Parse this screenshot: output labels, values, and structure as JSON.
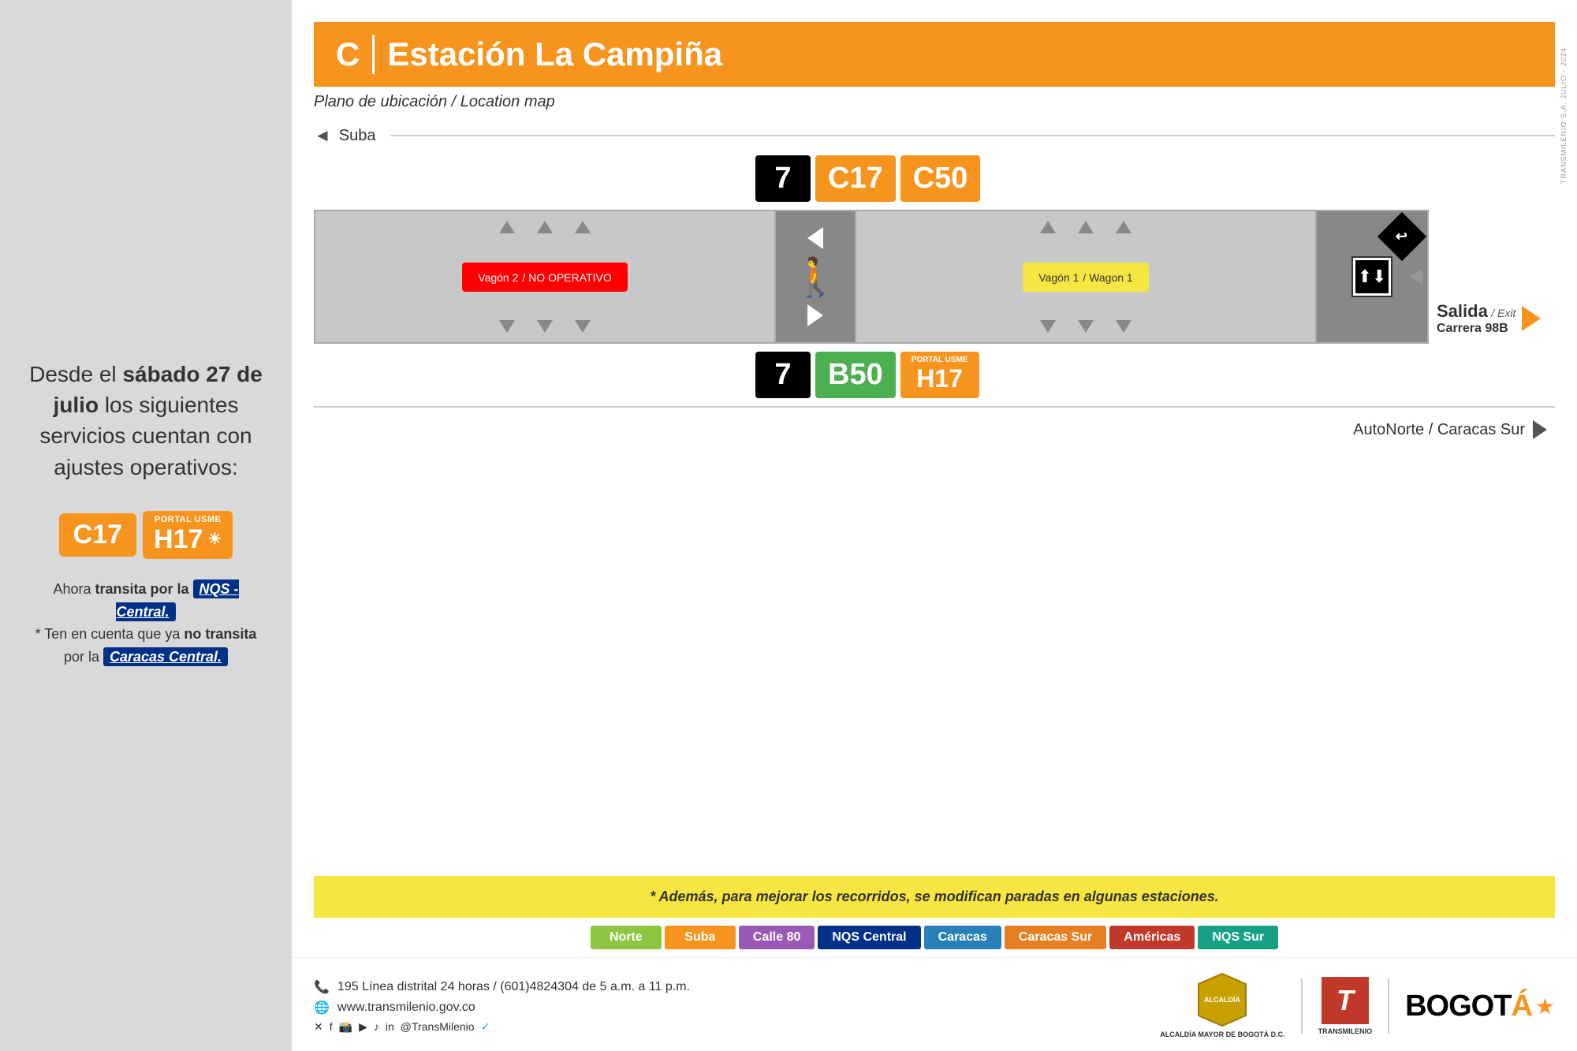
{
  "leftPanel": {
    "intro": "Desde el ",
    "dateStrong": "sábado 27 de julio",
    "rest": " los siguientes servicios cuentan con ajustes operativos:",
    "routes": {
      "c17Label": "C17",
      "h17Portal": "PORTAL USME",
      "h17Num": "H17"
    },
    "transitInfo1": "Ahora ",
    "transitStrong": "transita por la ",
    "nqsCentral": "NQS - Central.",
    "note": "* Ten en cuenta que ya ",
    "noTransita": "no transita",
    "noteRest": " por la ",
    "caracasCentral": "Caracas Central."
  },
  "header": {
    "letter": "C",
    "stationName": "Estación La Campiña",
    "subtitle": "Plano de ubicación",
    "subtitleEn": "/ Location map"
  },
  "verticalLabel": "TRANSMILENIO S.A. JULIO - 2024",
  "map": {
    "subaLabel": "Suba",
    "routesTop": {
      "r7": "7",
      "rC17": "C17",
      "rC50": "C50"
    },
    "wagon2": {
      "label": "Vagón 2",
      "sublabel": "/ NO OPERATIVO"
    },
    "wagon1": {
      "label": "Vagón 1",
      "sublabel": "/ Wagon 1"
    },
    "salida": "Salida",
    "salidaEn": "/ Exit",
    "carrera": "Carrera 98B",
    "routesBottom": {
      "r7": "7",
      "rB50": "B50",
      "h17Portal": "PORTAL USME",
      "rH17": "H17"
    },
    "autoNorte": "AutoNorte / Caracas Sur"
  },
  "banner": {
    "text": "* Además, para mejorar los recorridos, se modifican paradas en algunas estaciones."
  },
  "legend": {
    "items": [
      {
        "label": "Norte",
        "color": "#8dc63f"
      },
      {
        "label": "Suba",
        "color": "#f7941d"
      },
      {
        "label": "Calle 80",
        "color": "#9b59b6"
      },
      {
        "label": "NQS Central",
        "color": "#003087"
      },
      {
        "label": "Caracas",
        "color": "#2980b9"
      },
      {
        "label": "Caracas Sur",
        "color": "#e67e22"
      },
      {
        "label": "Américas",
        "color": "#c0392b"
      },
      {
        "label": "NQS Sur",
        "color": "#16a085"
      }
    ]
  },
  "footer": {
    "phone": "195 Línea distrital 24 horas / (601)4824304 de 5 a.m. a 11 p.m.",
    "web": "www.transmilenio.gov.co",
    "social": "@TransMilenio",
    "alcaldiaName": "ALCALDÍA MAYOR DE BOGOTÁ D.C.",
    "bogotaText": "BOGOTÁ"
  }
}
